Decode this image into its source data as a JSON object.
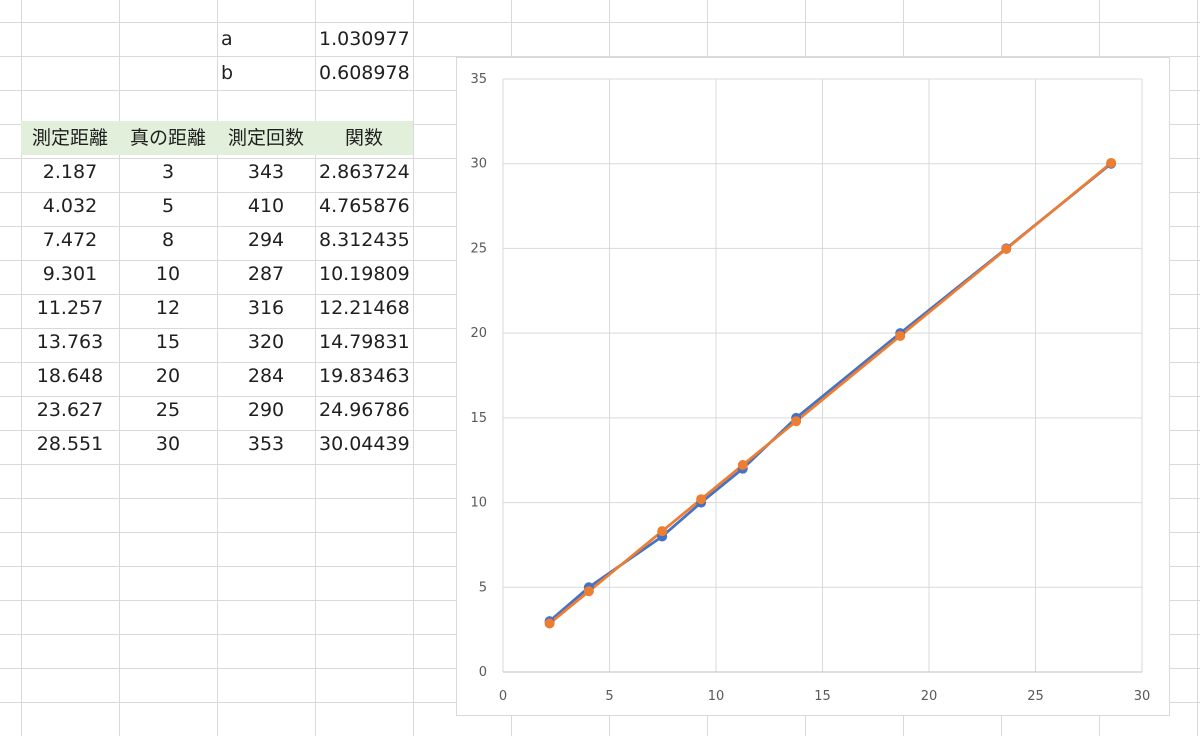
{
  "params": {
    "a_label": "a",
    "a_value": "1.030977",
    "b_label": "b",
    "b_value": "0.608978"
  },
  "table": {
    "headers": [
      "測定距離",
      "真の距離",
      "測定回数",
      "関数"
    ],
    "rows": [
      [
        "2.187",
        "3",
        "343",
        "2.863724"
      ],
      [
        "4.032",
        "5",
        "410",
        "4.765876"
      ],
      [
        "7.472",
        "8",
        "294",
        "8.312435"
      ],
      [
        "9.301",
        "10",
        "287",
        "10.19809"
      ],
      [
        "11.257",
        "12",
        "316",
        "12.21468"
      ],
      [
        "13.763",
        "15",
        "320",
        "14.79831"
      ],
      [
        "18.648",
        "20",
        "284",
        "19.83463"
      ],
      [
        "23.627",
        "25",
        "290",
        "24.96786"
      ],
      [
        "28.551",
        "30",
        "353",
        "30.04439"
      ]
    ]
  },
  "colors": {
    "header_fill": "#e2efda",
    "grid_line": "#d9d9d9",
    "series_1": "#4472c4",
    "series_2": "#ed7d31"
  },
  "chart_data": {
    "type": "line",
    "x": [
      2.187,
      4.032,
      7.472,
      9.301,
      11.257,
      13.763,
      18.648,
      23.627,
      28.551
    ],
    "series": [
      {
        "values": [
          3,
          5,
          8,
          10,
          12,
          15,
          20,
          25,
          30
        ],
        "color": "#4472c4"
      },
      {
        "values": [
          2.863724,
          4.765876,
          8.312435,
          10.19809,
          12.21468,
          14.79831,
          19.83463,
          24.96786,
          30.04439
        ],
        "color": "#ed7d31"
      }
    ],
    "xlim": [
      0,
      30
    ],
    "ylim": [
      0,
      35
    ],
    "xticks": [
      "0",
      "5",
      "10",
      "15",
      "20",
      "25",
      "30"
    ],
    "yticks": [
      "0",
      "5",
      "10",
      "15",
      "20",
      "25",
      "30",
      "35"
    ],
    "grid": true,
    "legend": "none"
  }
}
